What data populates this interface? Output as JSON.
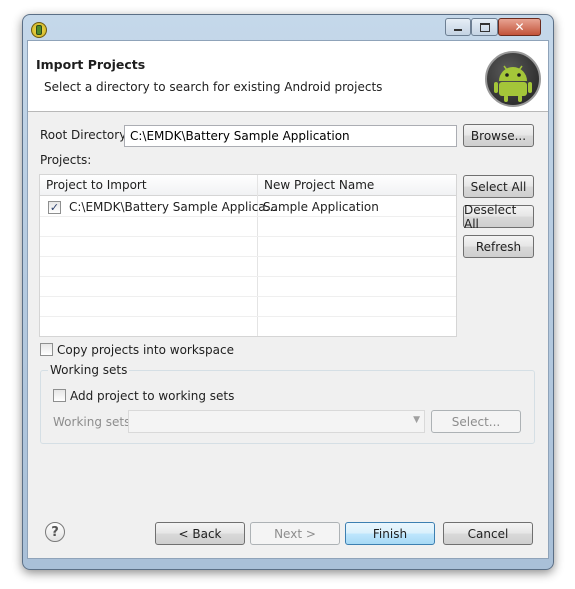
{
  "header": {
    "title": "Import Projects",
    "subtitle": "Select a directory to search for existing Android projects"
  },
  "root_directory": {
    "label": "Root Directory:",
    "value": "C:\\EMDK\\Battery Sample Application",
    "browse_label": "Browse..."
  },
  "projects": {
    "label": "Projects:",
    "columns": [
      "Project to Import",
      "New Project Name"
    ],
    "rows": [
      {
        "project": "C:\\EMDK\\Battery Sample Applica...",
        "name": "Sample Application",
        "checked": true
      }
    ],
    "select_all_label": "Select All",
    "deselect_all_label": "Deselect All",
    "refresh_label": "Refresh"
  },
  "copy_workspace_label": "Copy projects into workspace",
  "working_sets": {
    "group_label": "Working sets",
    "add_label": "Add project to working sets",
    "field_label": "Working sets:",
    "select_label": "Select..."
  },
  "footer": {
    "back_label": "< Back",
    "next_label": "Next >",
    "finish_label": "Finish",
    "cancel_label": "Cancel"
  }
}
